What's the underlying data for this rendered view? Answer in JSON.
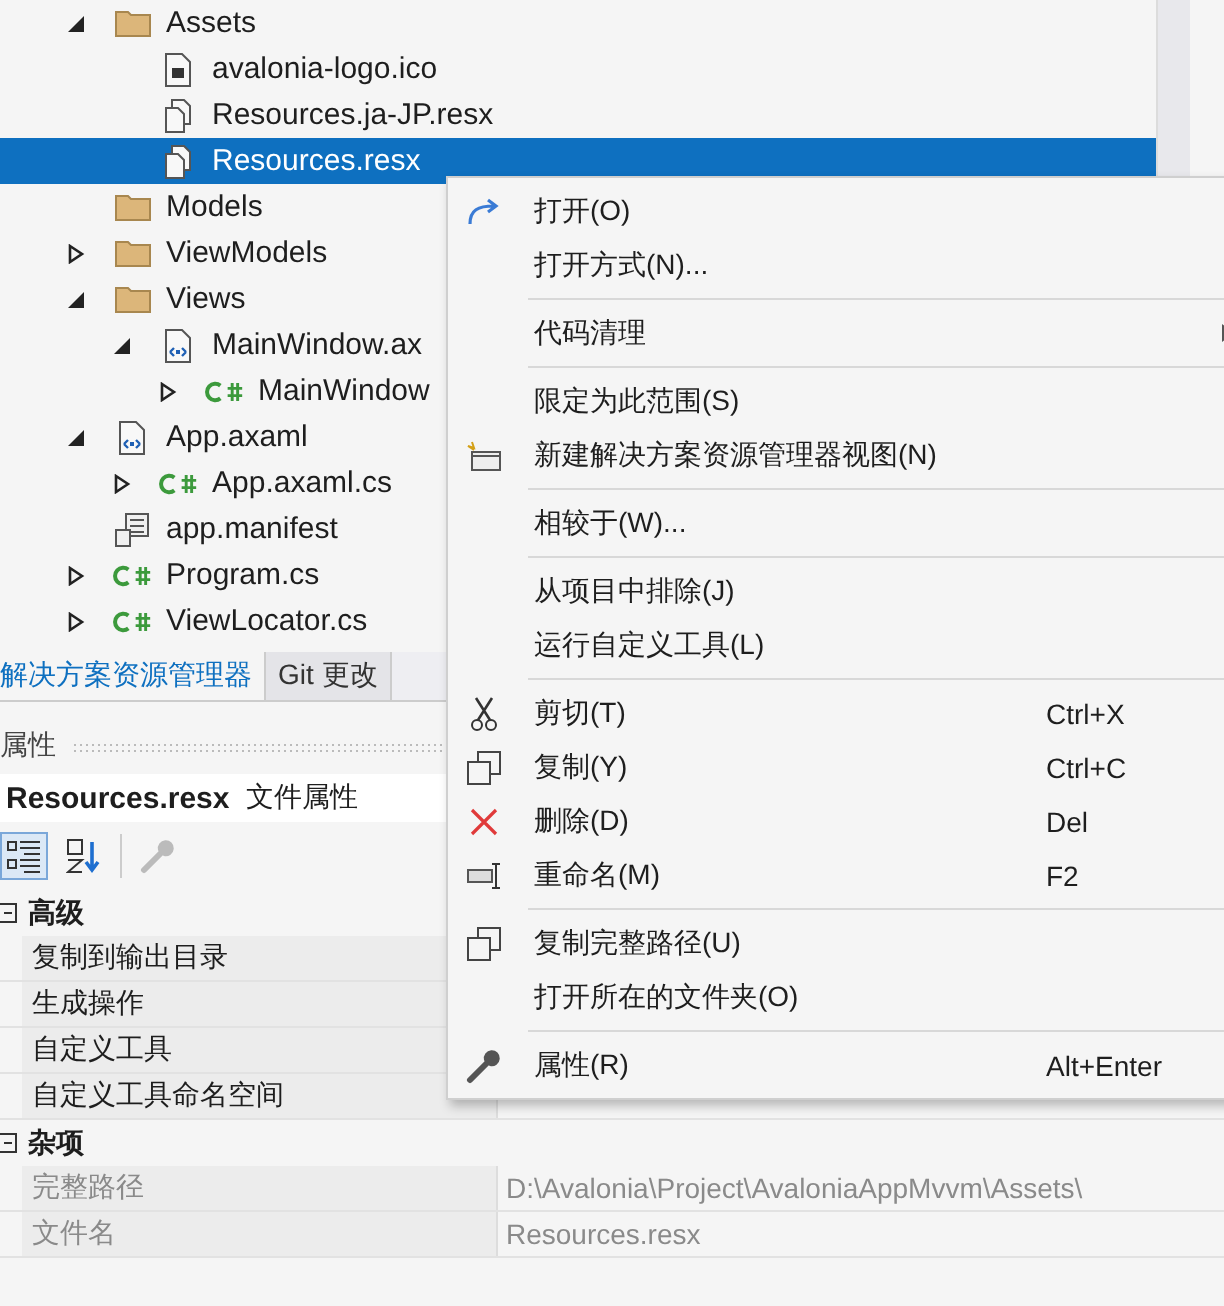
{
  "tree": [
    {
      "label": "Assets",
      "kind": "folder",
      "selected": false,
      "expanded": true,
      "children": [
        {
          "label": "avalonia-logo.ico",
          "kind": "ico",
          "selected": false
        },
        {
          "label": "Resources.ja-JP.resx",
          "kind": "resx",
          "selected": false
        },
        {
          "label": "Resources.resx",
          "kind": "resx",
          "selected": true
        }
      ]
    },
    {
      "label": "Models",
      "kind": "folder",
      "selected": false
    },
    {
      "label": "ViewModels",
      "kind": "folder",
      "selected": false,
      "expanded": false
    },
    {
      "label": "Views",
      "kind": "folder",
      "selected": false,
      "expanded": true,
      "children": [
        {
          "label": "MainWindow.ax",
          "kind": "axaml",
          "selected": false,
          "expanded": true,
          "children": [
            {
              "label": "MainWindow",
              "kind": "csharp",
              "selected": false,
              "expanded": false
            }
          ]
        }
      ]
    },
    {
      "label": "App.axaml",
      "kind": "axaml",
      "selected": false,
      "expanded": true,
      "children": [
        {
          "label": "App.axaml.cs",
          "kind": "csharp",
          "selected": false,
          "expanded": false
        }
      ]
    },
    {
      "label": "app.manifest",
      "kind": "manifest",
      "selected": false
    },
    {
      "label": "Program.cs",
      "kind": "csharp",
      "selected": false,
      "expanded": false
    },
    {
      "label": "ViewLocator.cs",
      "kind": "csharp",
      "selected": false,
      "expanded": false
    }
  ],
  "tabs": [
    {
      "label": "解决方案资源管理器",
      "selected": true
    },
    {
      "label": "Git 更改",
      "selected": false
    }
  ],
  "properties": {
    "title": "属性",
    "object_name": "Resources.resx",
    "object_type": "文件属性",
    "view_buttons": [
      {
        "kind": "categorized",
        "selected": true
      },
      {
        "kind": "alphabetical",
        "selected": false
      }
    ],
    "property_pages_disabled": true,
    "categories": [
      {
        "label": "高级",
        "expanded": true,
        "rows": [
          {
            "name": "复制到输出目录",
            "readonly": false
          },
          {
            "name": "生成操作",
            "readonly": false
          },
          {
            "name": "自定义工具",
            "readonly": false
          },
          {
            "name": "自定义工具命名空间",
            "readonly": false
          }
        ]
      },
      {
        "label": "杂项",
        "expanded": true,
        "rows": [
          {
            "name": "完整路径",
            "value": "D:\\Avalonia\\Project\\AvaloniaAppMvvm\\Assets\\",
            "readonly": true
          },
          {
            "name": "文件名",
            "value": "Resources.resx",
            "readonly": true
          }
        ]
      }
    ]
  },
  "context_menu": [
    {
      "kind": "open",
      "label": "打开(O)"
    },
    {
      "kind": "plain",
      "label": "打开方式(N)..."
    },
    {
      "kind": "separator"
    },
    {
      "kind": "submenu",
      "label": "代码清理"
    },
    {
      "kind": "separator"
    },
    {
      "kind": "plain",
      "label": "限定为此范围(S)"
    },
    {
      "kind": "new-view",
      "label": "新建解决方案资源管理器视图(N)"
    },
    {
      "kind": "separator"
    },
    {
      "kind": "plain",
      "label": "相较于(W)..."
    },
    {
      "kind": "separator"
    },
    {
      "kind": "plain",
      "label": "从项目中排除(J)"
    },
    {
      "kind": "plain",
      "label": "运行自定义工具(L)"
    },
    {
      "kind": "separator"
    },
    {
      "kind": "cut",
      "label": "剪切(T)",
      "shortcut": "Ctrl+X"
    },
    {
      "kind": "copy",
      "label": "复制(Y)",
      "shortcut": "Ctrl+C"
    },
    {
      "kind": "delete",
      "label": "删除(D)",
      "shortcut": "Del"
    },
    {
      "kind": "rename",
      "label": "重命名(M)",
      "shortcut": "F2"
    },
    {
      "kind": "separator"
    },
    {
      "kind": "copy",
      "label": "复制完整路径(U)"
    },
    {
      "kind": "plain",
      "label": "打开所在的文件夹(O)"
    },
    {
      "kind": "separator"
    },
    {
      "kind": "properties",
      "label": "属性(R)",
      "shortcut": "Alt+Enter"
    }
  ]
}
